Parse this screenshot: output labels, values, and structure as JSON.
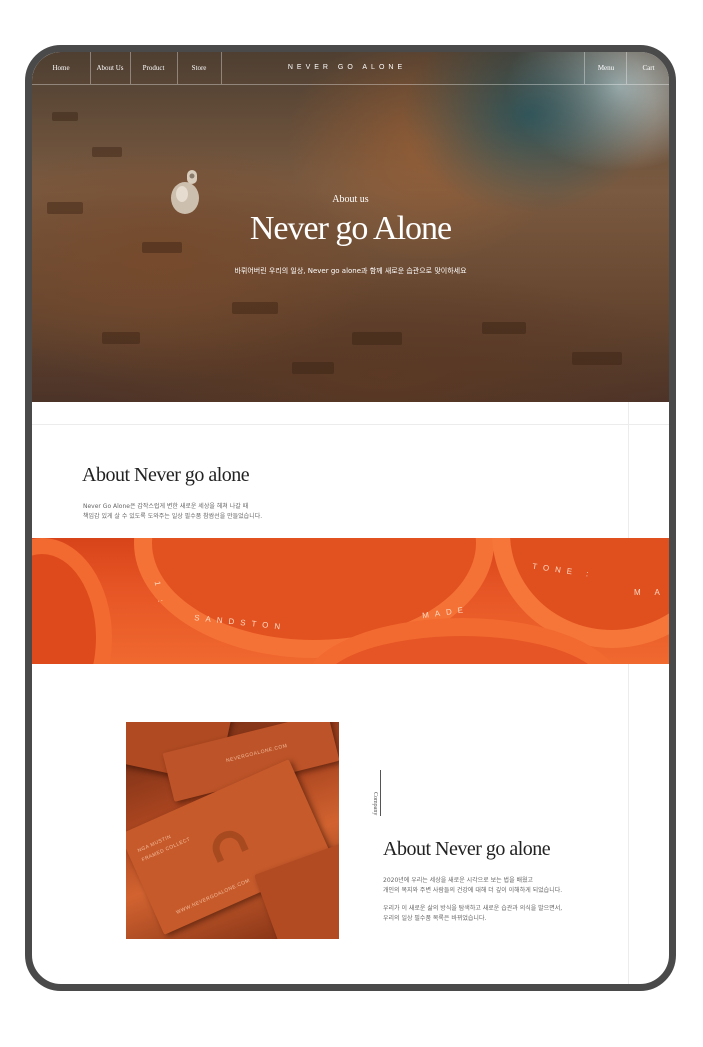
{
  "nav": {
    "items": [
      "Home",
      "About Us",
      "Product",
      "Store"
    ],
    "brand": "NEVER GO ALONE",
    "right_items": [
      "Menu",
      "Cart"
    ]
  },
  "hero": {
    "subtitle": "About us",
    "title": "Never go Alone",
    "description": "바뤼어버린 우리의 일상, Never go alone과 함께 새로운 습관으로 맞이하세요"
  },
  "about": {
    "title": "About Never go alone",
    "description_line1": "Never Go Alone은 갑작스럽게 변한 새로운 세상을 헤쳐 나갈 때",
    "description_line2": "책임감 있게 살 수 있도록 도와주는 일상 필수품 참쌈선을 만들었습니다."
  },
  "band": {
    "ring_texts": [
      "SANDSTON",
      "MADE",
      "TONE :",
      "M A",
      "1 :"
    ]
  },
  "company": {
    "vertical_label": "Company",
    "title": "About Never go alone",
    "para1_line1": "2020년에 우리는 세상을 새로운 시각으로 보는 법을 배웠고",
    "para1_line2": "개인의 복지와 주변 사람들의 건강에 대해 더 깊이 이해하게 되었습니다.",
    "para2_line1": "우리가 이 새로운 삶의 방식을 탐색하고 새로운 습관과 의식을 발으면서,",
    "para2_line2": "우리의 일상 필수품 목록은 바뀌었습니다."
  },
  "cards": {
    "card1": "NGA MUSTIN",
    "card1b": "FRAMED COLLECT",
    "card2": "NEVERGOALONE.COM",
    "card3": "WWW.NEVERGOALONE.COM"
  },
  "colors": {
    "accent_orange": "#e65525",
    "device_frame": "#4a4a4a",
    "text_dark": "#222222"
  }
}
